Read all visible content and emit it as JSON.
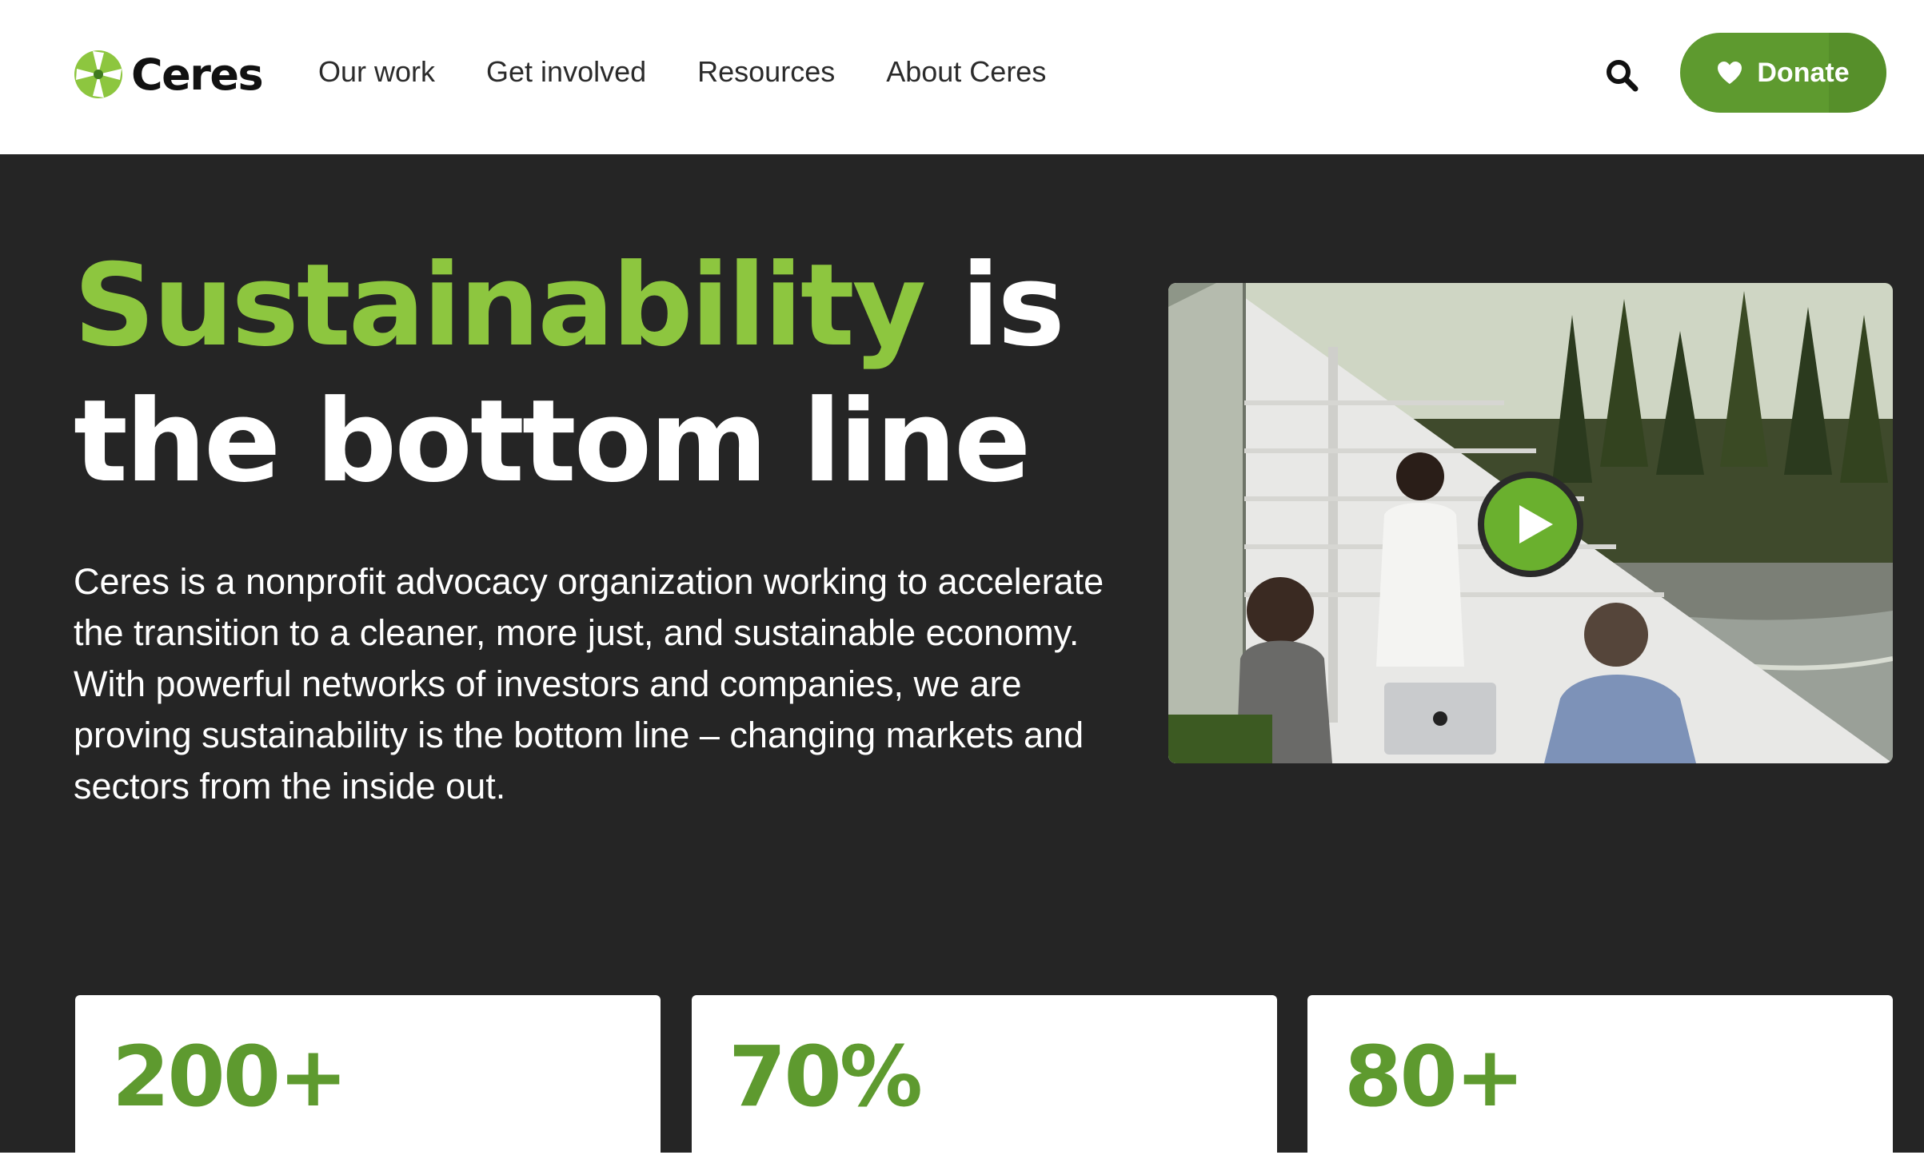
{
  "brand": {
    "name": "Ceres",
    "accent_color": "#8dc63f",
    "button_color": "#5e9a2f",
    "hero_background": "#252525"
  },
  "nav": {
    "items": [
      {
        "label": "Our work"
      },
      {
        "label": "Get involved"
      },
      {
        "label": "Resources"
      },
      {
        "label": "About Ceres"
      }
    ],
    "search_icon": "search-icon",
    "donate_label": "Donate",
    "donate_icon": "heart-icon"
  },
  "hero": {
    "headline_accent": "Sustainability",
    "headline_rest_1": " is",
    "headline_rest_2": "the bottom line",
    "intro": "Ceres is a nonprofit advocacy organization working to accelerate the transition to a cleaner, more just, and sustainable economy. With powerful networks of investors and companies, we are proving sustainability is the bottom line – changing markets and sectors from the inside out.",
    "video_play_icon": "play-icon"
  },
  "stats": [
    {
      "value": "200+"
    },
    {
      "value": "70%"
    },
    {
      "value": "80+"
    }
  ]
}
